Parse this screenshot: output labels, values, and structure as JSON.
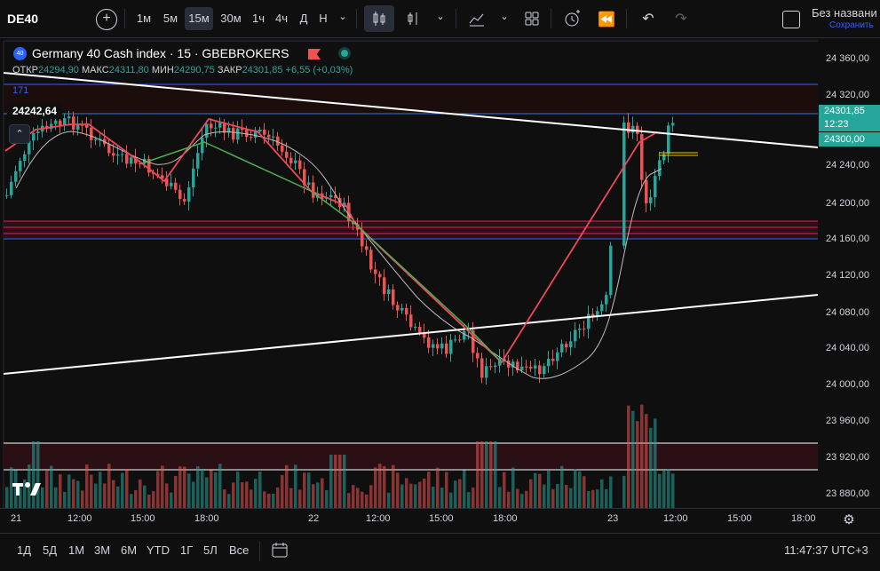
{
  "toolbar": {
    "symbol": "DE40",
    "intervals": [
      "1м",
      "5м",
      "15м",
      "30м",
      "1ч",
      "4ч",
      "Д",
      "Н"
    ],
    "active_interval": "15м",
    "layout_title": "Без названи",
    "layout_sub": "Сохранить"
  },
  "legend": {
    "badge": "40",
    "title": "Germany 40 Cash index · 15 · GBEBROKERS",
    "open_label": "ОТКР",
    "open": "24294,90",
    "high_label": "МАКС",
    "high": "24311,80",
    "low_label": "МИН",
    "low": "24290,75",
    "close_label": "ЗАКР",
    "close": "24301,85",
    "change": "+6,55 (+0,03%)",
    "indicator_value": "171",
    "left_price_label": "24242,64"
  },
  "price_axis": {
    "labels": [
      "24 360,00",
      "24 320,00",
      "24 280,00",
      "24 240,00",
      "24 200,00",
      "24 160,00",
      "24 120,00",
      "24 080,00",
      "24 040,00",
      "24 000,00",
      "23 960,00",
      "23 920,00",
      "23 880,00"
    ],
    "current_price": "24301,85",
    "countdown": "12:23",
    "alert_price": "24300,00",
    "accent_color": "#26a69a"
  },
  "time_axis": {
    "labels": [
      "21",
      "12:00",
      "15:00",
      "18:00",
      "22",
      "12:00",
      "15:00",
      "18:00",
      "23",
      "12:00",
      "15:00",
      "18:00"
    ]
  },
  "bottombar": {
    "ranges": [
      "1Д",
      "5Д",
      "1М",
      "3М",
      "6М",
      "YTD",
      "1Г",
      "5Л",
      "Все"
    ],
    "clock": "11:47:37 UTC+3"
  },
  "colors": {
    "up": "#26a69a",
    "down": "#ef5350",
    "bg": "#0f0f0f"
  }
}
